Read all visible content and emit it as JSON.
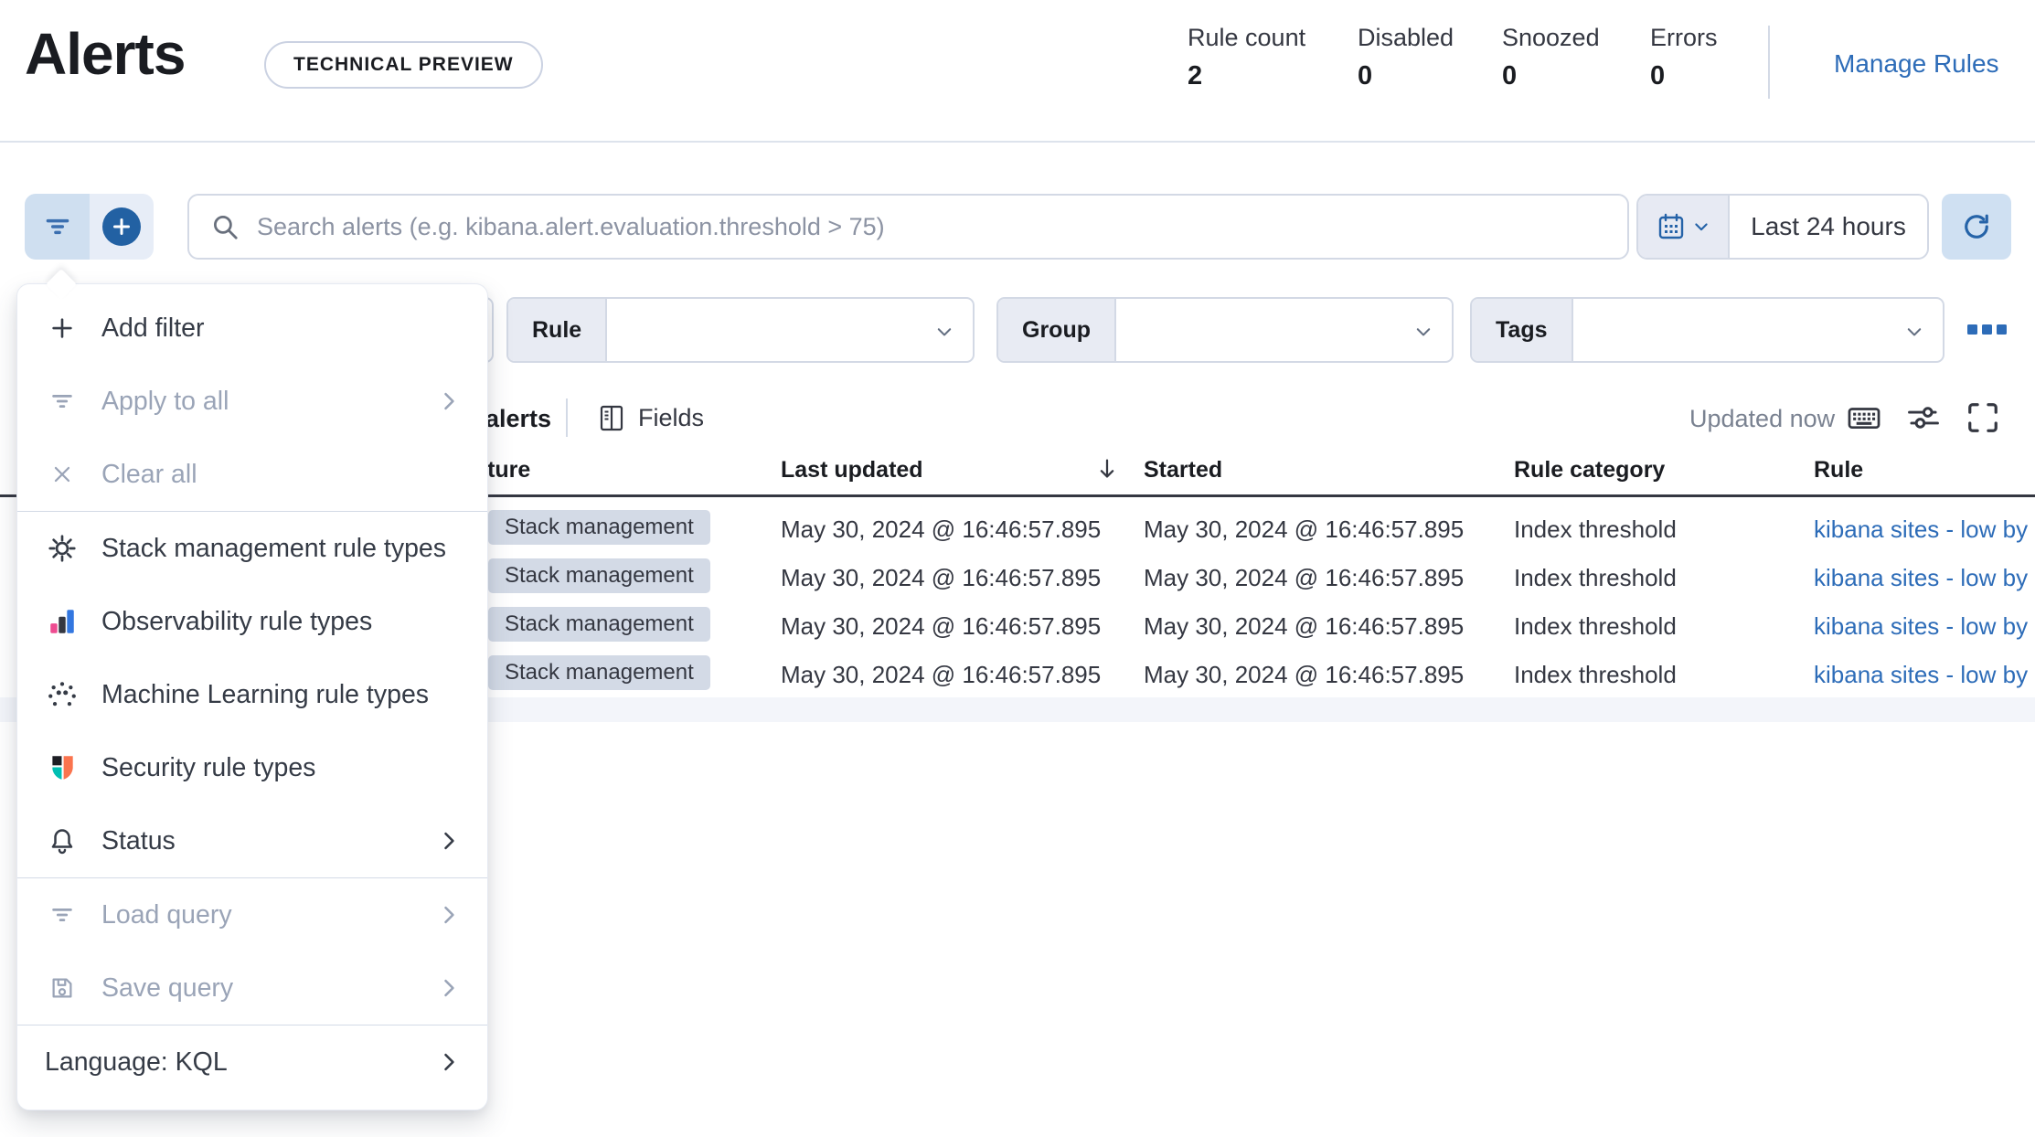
{
  "page": {
    "title": "Alerts",
    "preview_badge": "TECHNICAL PREVIEW"
  },
  "stats": {
    "items": [
      {
        "label": "Rule count",
        "value": "2"
      },
      {
        "label": "Disabled",
        "value": "0"
      },
      {
        "label": "Snoozed",
        "value": "0"
      },
      {
        "label": "Errors",
        "value": "0"
      }
    ],
    "manage_rules": "Manage Rules"
  },
  "search_bar": {
    "placeholder": "Search alerts (e.g. kibana.alert.evaluation.threshold > 75)",
    "time_range": "Last 24 hours"
  },
  "filter_selects": {
    "rule": "Rule",
    "group": "Group",
    "tags": "Tags"
  },
  "filter_menu": {
    "add_filter": "Add filter",
    "apply_to_all": "Apply to all",
    "clear_all": "Clear all",
    "stack_management": "Stack management rule types",
    "observability": "Observability rule types",
    "machine_learning": "Machine Learning rule types",
    "security": "Security rule types",
    "status": "Status",
    "load_query": "Load query",
    "save_query": "Save query",
    "language": "Language: KQL"
  },
  "toolbar": {
    "alerts_label": "alerts",
    "fields_label": "Fields",
    "updated_label": "Updated now"
  },
  "table": {
    "columns": [
      "Feature",
      "Last updated",
      "Started",
      "Rule category",
      "Rule"
    ],
    "rows": [
      {
        "feature": "Stack management",
        "last_updated": "May 30, 2024 @ 16:46:57.895",
        "started": "May 30, 2024 @ 16:46:57.895",
        "rule_category": "Index threshold",
        "rule": "kibana sites - low by"
      },
      {
        "feature": "Stack management",
        "last_updated": "May 30, 2024 @ 16:46:57.895",
        "started": "May 30, 2024 @ 16:46:57.895",
        "rule_category": "Index threshold",
        "rule": "kibana sites - low by"
      },
      {
        "feature": "Stack management",
        "last_updated": "May 30, 2024 @ 16:46:57.895",
        "started": "May 30, 2024 @ 16:46:57.895",
        "rule_category": "Index threshold",
        "rule": "kibana sites - low by"
      },
      {
        "feature": "Stack management",
        "last_updated": "May 30, 2024 @ 16:46:57.895",
        "started": "May 30, 2024 @ 16:46:57.895",
        "rule_category": "Index threshold",
        "rule": "kibana sites - low by"
      }
    ]
  },
  "colors": {
    "accent_blue": "#2563a8",
    "link_blue": "#2d6cb8",
    "badge_bg": "#d3dae6",
    "text_dark": "#343741",
    "disabled_text": "#9aa4b7",
    "observability_pink": "#ee4c91",
    "observability_blue": "#3377e0",
    "security_coral": "#fa744e",
    "security_teal": "#00bfb3"
  }
}
